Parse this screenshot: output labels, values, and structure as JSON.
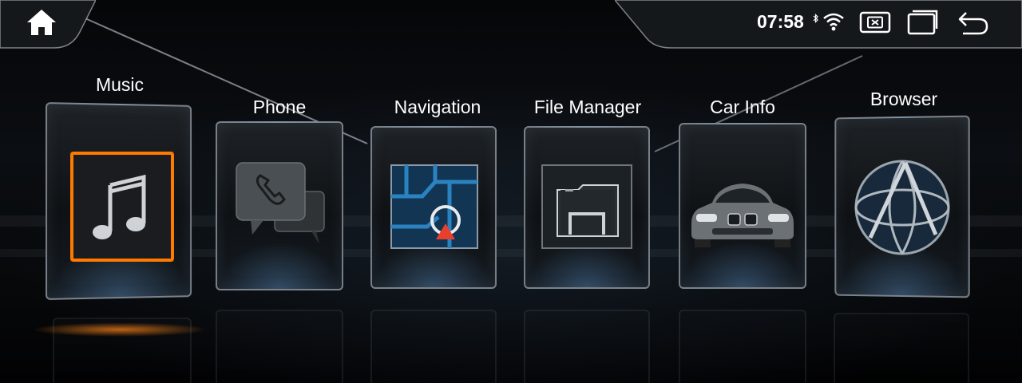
{
  "status_bar": {
    "time": "07:58",
    "icons": [
      "bluetooth-icon",
      "wifi-icon",
      "close-window-icon",
      "recent-apps-icon",
      "back-icon"
    ]
  },
  "nav": {
    "home_icon": "home-icon"
  },
  "apps": [
    {
      "label": "Music",
      "icon": "music-note-icon",
      "selected": true
    },
    {
      "label": "Phone",
      "icon": "phone-chat-icon",
      "selected": false
    },
    {
      "label": "Navigation",
      "icon": "map-pin-icon",
      "selected": false
    },
    {
      "label": "File Manager",
      "icon": "folder-icon",
      "selected": false
    },
    {
      "label": "Car Info",
      "icon": "car-icon",
      "selected": false
    },
    {
      "label": "Browser",
      "icon": "globe-icon",
      "selected": false
    }
  ],
  "colors": {
    "accent": "#ff7a00",
    "nav_blue": "#1c5a8a",
    "arrow_red": "#e8402c"
  }
}
